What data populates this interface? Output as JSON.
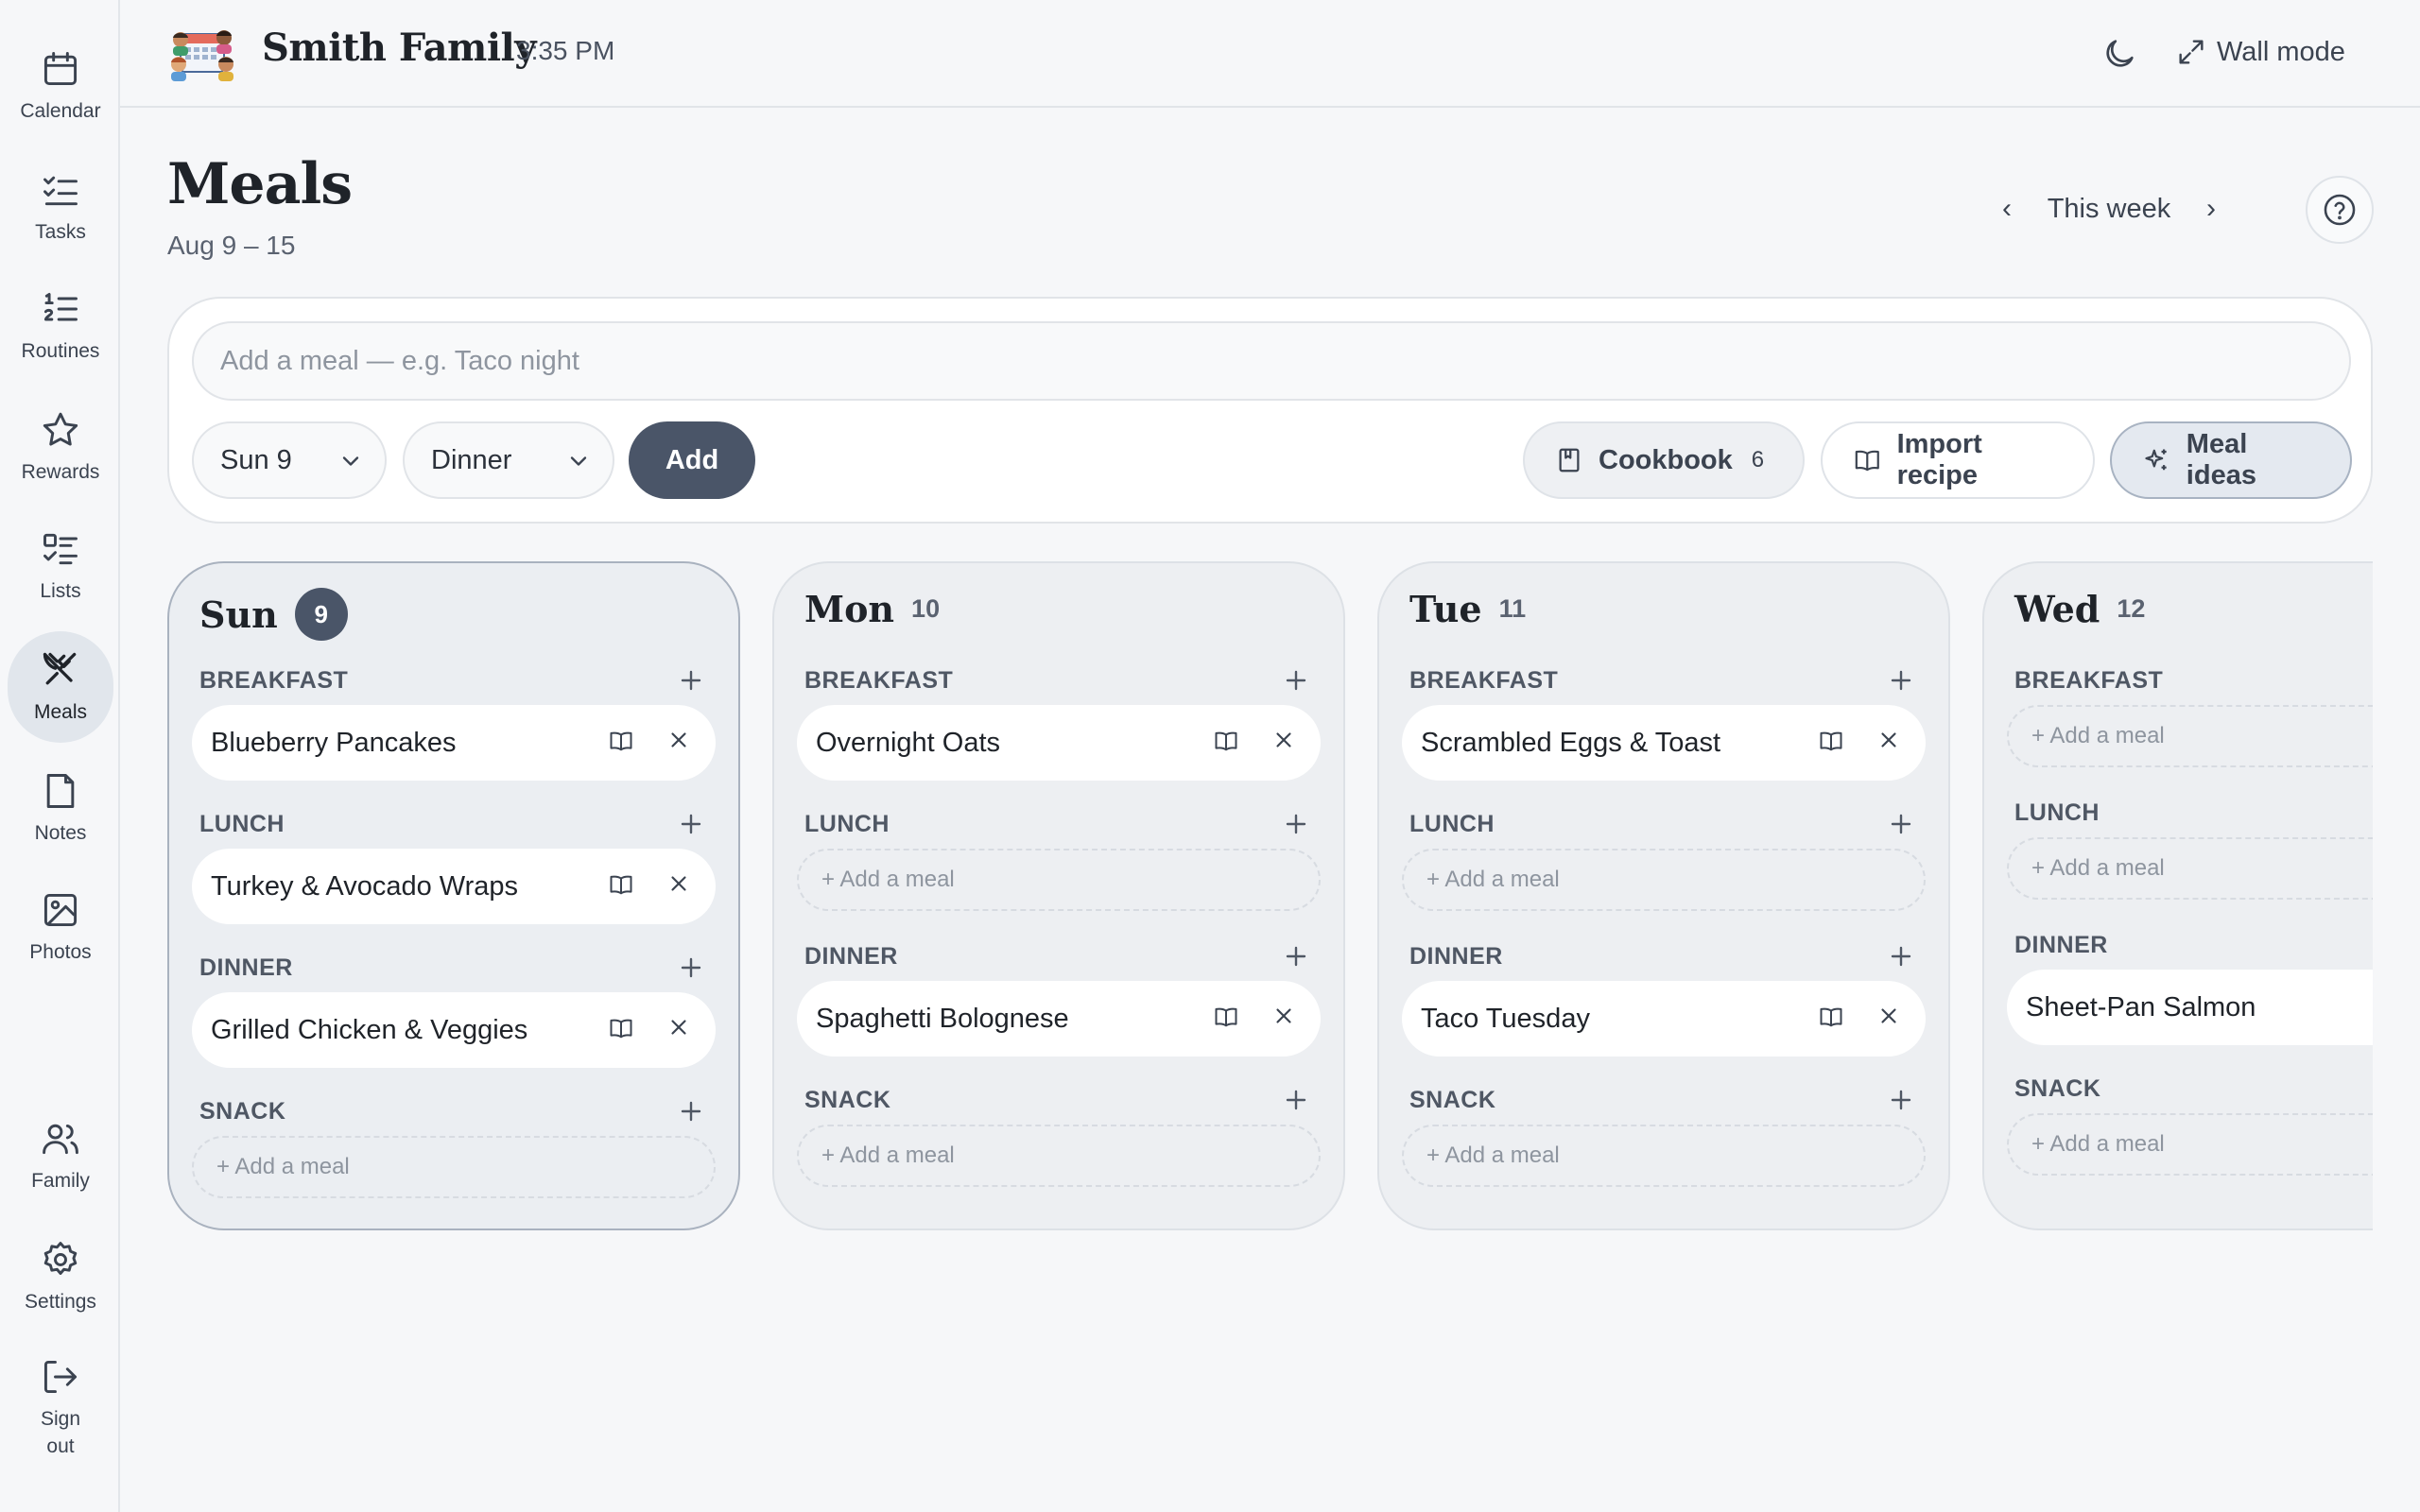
{
  "sidebar": {
    "items": [
      {
        "label": "Calendar",
        "icon": "calendar-icon"
      },
      {
        "label": "Tasks",
        "icon": "tasks-icon"
      },
      {
        "label": "Routines",
        "icon": "routines-icon"
      },
      {
        "label": "Rewards",
        "icon": "star-icon"
      },
      {
        "label": "Lists",
        "icon": "list-icon"
      },
      {
        "label": "Meals",
        "icon": "utensils-icon",
        "active": true
      },
      {
        "label": "Notes",
        "icon": "note-icon"
      },
      {
        "label": "Photos",
        "icon": "image-icon"
      }
    ],
    "bottom_items": [
      {
        "label": "Family",
        "icon": "users-icon"
      },
      {
        "label": "Settings",
        "icon": "gear-icon"
      },
      {
        "label": "Sign out",
        "icon": "logout-icon"
      }
    ]
  },
  "header": {
    "family_name": "Smith Family",
    "time": "3:35 PM",
    "wall_mode_label": "Wall mode"
  },
  "page": {
    "title": "Meals",
    "date_range": "Aug 9 – 15",
    "week_label": "This week",
    "prev_arrow": "‹",
    "next_arrow": "›"
  },
  "composer": {
    "placeholder": "Add a meal — e.g. Taco night",
    "day_select": "Sun 9",
    "slot_select": "Dinner",
    "add_label": "Add",
    "cookbook_label": "Cookbook",
    "cookbook_count": "6",
    "import_label": "Import recipe",
    "ideas_label": "Meal ideas"
  },
  "empty_label": "+ Add a meal",
  "days": [
    {
      "name": "Sun",
      "num": "9",
      "today": true,
      "slots": [
        {
          "label": "BREAKFAST",
          "meal": "Blueberry Pancakes"
        },
        {
          "label": "LUNCH",
          "meal": "Turkey & Avocado Wraps"
        },
        {
          "label": "DINNER",
          "meal": "Grilled Chicken & Veggies"
        },
        {
          "label": "SNACK",
          "meal": null
        }
      ]
    },
    {
      "name": "Mon",
      "num": "10",
      "today": false,
      "slots": [
        {
          "label": "BREAKFAST",
          "meal": "Overnight Oats"
        },
        {
          "label": "LUNCH",
          "meal": null
        },
        {
          "label": "DINNER",
          "meal": "Spaghetti Bolognese"
        },
        {
          "label": "SNACK",
          "meal": null
        }
      ]
    },
    {
      "name": "Tue",
      "num": "11",
      "today": false,
      "slots": [
        {
          "label": "BREAKFAST",
          "meal": "Scrambled Eggs & Toast"
        },
        {
          "label": "LUNCH",
          "meal": null
        },
        {
          "label": "DINNER",
          "meal": "Taco Tuesday"
        },
        {
          "label": "SNACK",
          "meal": null
        }
      ]
    },
    {
      "name": "Wed",
      "num": "12",
      "today": false,
      "slots": [
        {
          "label": "BREAKFAST",
          "meal": null
        },
        {
          "label": "LUNCH",
          "meal": null
        },
        {
          "label": "DINNER",
          "meal": "Sheet-Pan Salmon"
        },
        {
          "label": "SNACK",
          "meal": null
        }
      ]
    }
  ],
  "colors": {
    "accent": "#4a5568",
    "background": "#f6f7f9",
    "card": "#ffffff",
    "column": "#edeff2"
  }
}
